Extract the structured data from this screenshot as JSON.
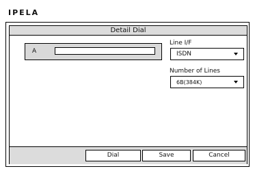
{
  "brand": "IPELA",
  "dialog": {
    "title": "Detail Dial",
    "entry_label": "A",
    "entry_value": ""
  },
  "line_if": {
    "label": "Line I/F",
    "value": "ISDN"
  },
  "lines": {
    "label": "Number of Lines",
    "value": "6B(384K)"
  },
  "buttons": {
    "dial": "Dial",
    "save": "Save",
    "cancel": "Cancel"
  },
  "icons": {
    "dropdown": "chevron-down-icon"
  },
  "colors": {
    "bar_gray": "#dcdcdc",
    "entry_gray": "#d9d9d9",
    "border": "#000000"
  }
}
